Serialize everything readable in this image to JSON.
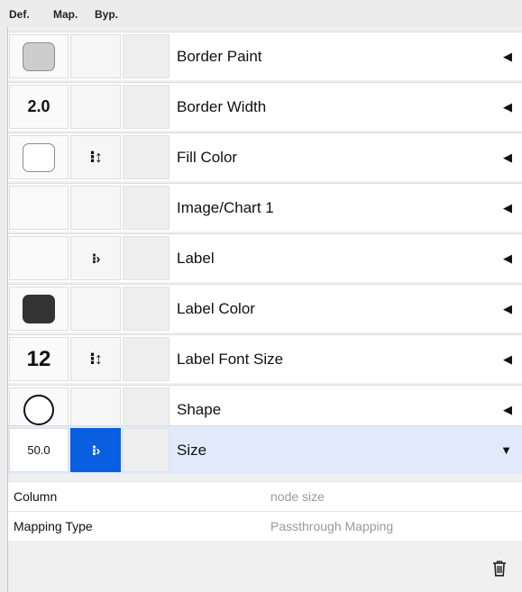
{
  "columns": {
    "def": "Def.",
    "map": "Map.",
    "byp": "Byp."
  },
  "properties": [
    {
      "name": "Border Paint",
      "def_label": "",
      "def_visual": "grey-swatch",
      "map_icon": "",
      "expanded": false,
      "arrow": "◀"
    },
    {
      "name": "Border Width",
      "def_label": "2.0",
      "def_visual": "text",
      "map_icon": "",
      "expanded": false,
      "arrow": "◀"
    },
    {
      "name": "Fill Color",
      "def_label": "",
      "def_visual": "white-swatch",
      "map_icon": "⁝↕",
      "expanded": false,
      "arrow": "◀"
    },
    {
      "name": "Image/Chart 1",
      "def_label": "",
      "def_visual": "none",
      "map_icon": "",
      "expanded": false,
      "arrow": "◀"
    },
    {
      "name": "Label",
      "def_label": "",
      "def_visual": "none",
      "map_icon": "⁝›",
      "expanded": false,
      "arrow": "◀"
    },
    {
      "name": "Label Color",
      "def_label": "",
      "def_visual": "dark-swatch",
      "map_icon": "",
      "expanded": false,
      "arrow": "◀"
    },
    {
      "name": "Label Font Size",
      "def_label": "12",
      "def_visual": "text",
      "map_icon": "⁝↕",
      "expanded": false,
      "arrow": "◀"
    },
    {
      "name": "Shape",
      "def_label": "",
      "def_visual": "circle",
      "map_icon": "",
      "expanded": false,
      "arrow": "◀"
    },
    {
      "name": "Size",
      "def_label": "50.0",
      "def_visual": "text",
      "map_icon": "⁝›",
      "expanded": true,
      "arrow": "▼"
    }
  ],
  "size_details": [
    {
      "key": "Column",
      "value": "node size"
    },
    {
      "key": "Mapping Type",
      "value": "Passthrough Mapping"
    }
  ],
  "colors": {
    "selected_row": "#e1eafb",
    "map_selected": "#0a5fe0"
  },
  "icons": {
    "delete": "trash-icon"
  }
}
